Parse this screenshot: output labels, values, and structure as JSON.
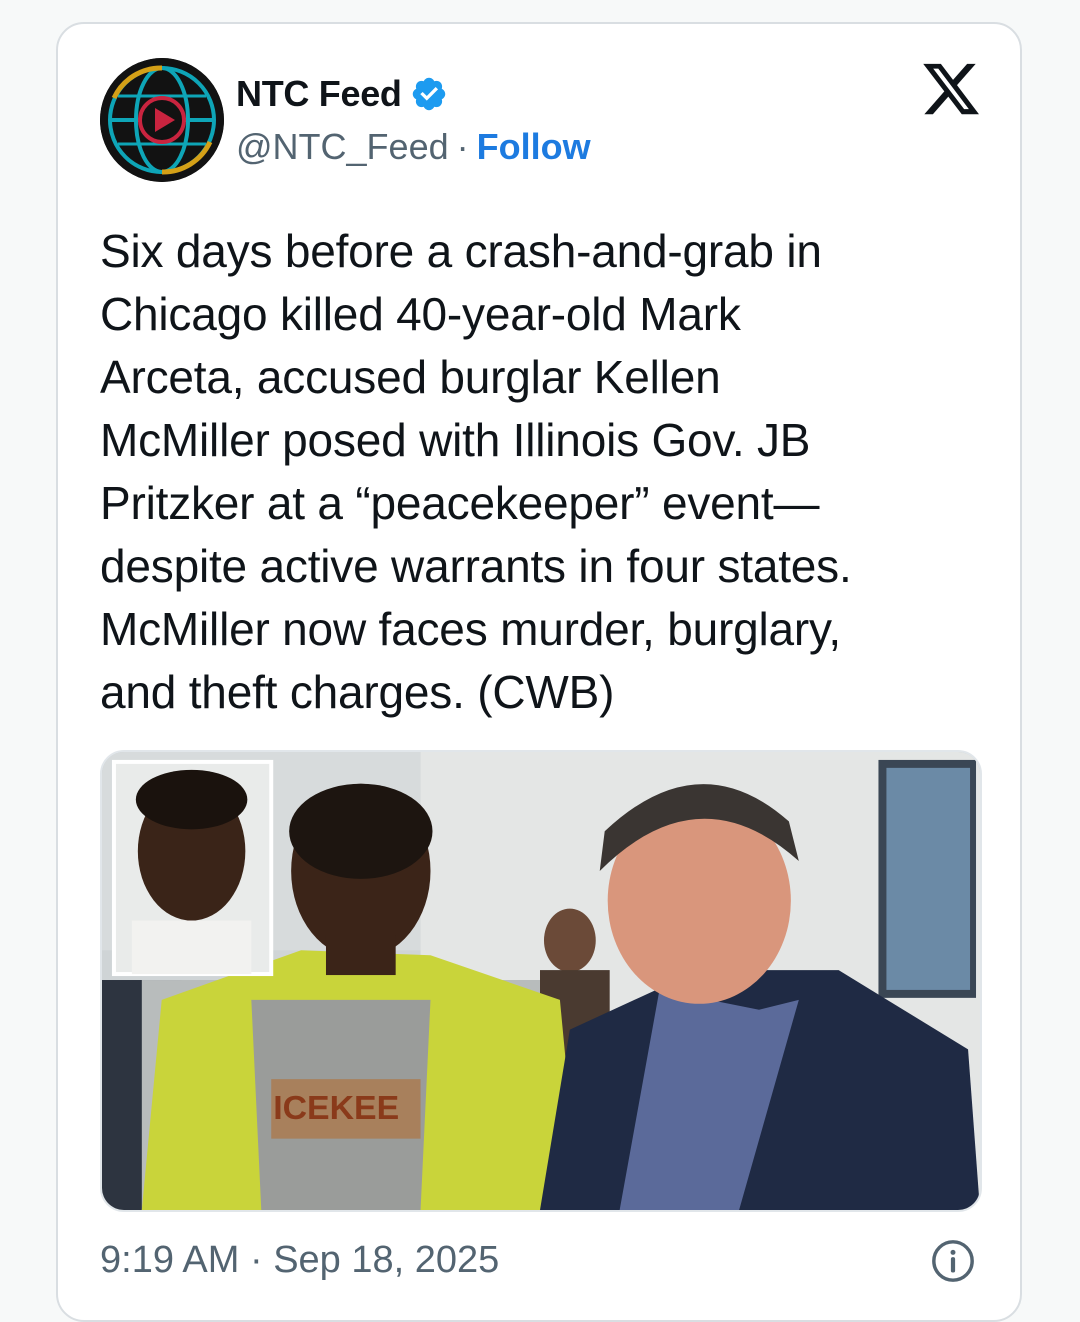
{
  "author": {
    "display_name": "NTC Feed",
    "handle": "@NTC_Feed",
    "separator": "·",
    "follow_label": "Follow",
    "verified": true
  },
  "tweet": {
    "text": "Six days before a crash-and-grab in\nChicago killed 40-year-old Mark\nArceta, accused burglar Kellen\nMcMiller posed with Illinois Gov. JB\nPritzker at a “peacekeeper” event—\ndespite active warrants in four states.\nMcMiller now faces murder, burglary,\nand theft charges. (CWB)",
    "timestamp": "9:19 AM · Sep 18, 2025",
    "vest_text": "ICEKEE"
  },
  "icons": {
    "brand": "x-logo-icon",
    "verified": "verified-badge-icon",
    "info": "info-icon"
  },
  "colors": {
    "follow": "#1d7be0",
    "verified": "#1d9bf0",
    "text": "#0f1419",
    "muted": "#536471"
  }
}
